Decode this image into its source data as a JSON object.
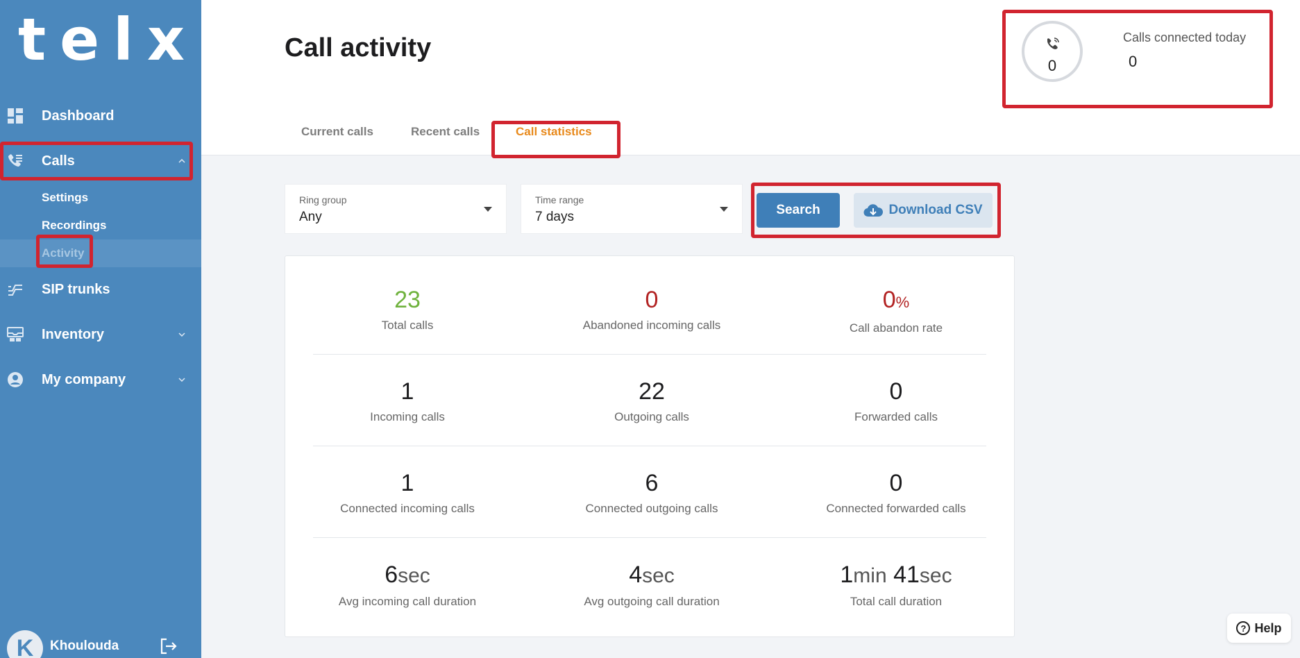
{
  "app": {
    "logo_text": "telxi"
  },
  "sidebar": {
    "items": [
      {
        "label": "Dashboard"
      },
      {
        "label": "Calls"
      },
      {
        "label": "SIP trunks"
      },
      {
        "label": "Inventory"
      },
      {
        "label": "My company"
      }
    ],
    "calls_sub": [
      {
        "label": "Settings"
      },
      {
        "label": "Recordings"
      },
      {
        "label": "Activity"
      }
    ],
    "user": {
      "initial": "K",
      "name": "Khoulouda"
    }
  },
  "header": {
    "title": "Call activity",
    "tabs": [
      {
        "label": "Current calls"
      },
      {
        "label": "Recent calls"
      },
      {
        "label": "Call statistics"
      }
    ],
    "today": {
      "count": "0",
      "label": "Calls connected today",
      "value": "0"
    }
  },
  "filters": {
    "ring_group": {
      "label": "Ring group",
      "value": "Any"
    },
    "time_range": {
      "label": "Time range",
      "value": "7 days"
    },
    "search_label": "Search",
    "csv_label": "Download CSV"
  },
  "stats": {
    "total_calls": {
      "value": "23",
      "label": "Total calls"
    },
    "abandoned": {
      "value": "0",
      "label": "Abandoned incoming calls"
    },
    "abandon_rate": {
      "value": "0",
      "unit": "%",
      "label": "Call abandon rate"
    },
    "incoming": {
      "value": "1",
      "label": "Incoming calls"
    },
    "outgoing": {
      "value": "22",
      "label": "Outgoing calls"
    },
    "forwarded": {
      "value": "0",
      "label": "Forwarded calls"
    },
    "conn_incoming": {
      "value": "1",
      "label": "Connected incoming calls"
    },
    "conn_outgoing": {
      "value": "6",
      "label": "Connected outgoing calls"
    },
    "conn_forwarded": {
      "value": "0",
      "label": "Connected forwarded calls"
    },
    "avg_incoming": {
      "value": "6",
      "unit": "sec",
      "label": "Avg incoming call duration"
    },
    "avg_outgoing": {
      "value": "4",
      "unit": "sec",
      "label": "Avg outgoing call duration"
    },
    "total_duration": {
      "min": "1",
      "min_unit": "min",
      "sec": "41",
      "sec_unit": "sec",
      "label": "Total call duration"
    }
  },
  "colors": {
    "sidebar_bg": "#4b88bd",
    "accent_orange": "#e8891b",
    "highlight_red": "#d1242f",
    "green_value": "#6fb23d",
    "red_value": "#b22222"
  },
  "help": {
    "label": "Help"
  }
}
